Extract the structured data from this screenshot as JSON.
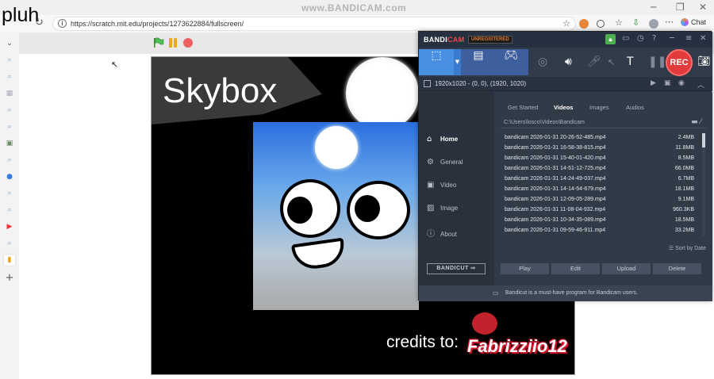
{
  "overlay": {
    "pluh": "pluh",
    "watermark": "www.BANDICAM.com"
  },
  "browser": {
    "url": "https://scratch.mit.edu/projects/1273622884/fullscreen/",
    "chat_label": "Chat",
    "window_controls": {
      "minimize": "─",
      "maximize": "❐",
      "close": "✕"
    }
  },
  "sidebar": {
    "icons": [
      "chevron-down-icon",
      "search-icon",
      "search-icon",
      "image-icon",
      "search-icon",
      "search-icon",
      "photos-icon",
      "search-icon",
      "edge-icon",
      "search-icon",
      "search-icon",
      "youtube-icon",
      "search-icon",
      "scratch-icon",
      "add-icon"
    ]
  },
  "scratch": {
    "stage_title": "Skybox",
    "credits": "credits to:",
    "signature": "Fabrizziio12"
  },
  "bandicam": {
    "logo_a": "BANDI",
    "logo_b": "CAM",
    "unregistered": "UNREGISTERED",
    "rec_label": "REC",
    "resolution": "1920x1020 - (0, 0), (1920, 1020)",
    "nav": [
      {
        "label": "Home",
        "icon": "home-icon"
      },
      {
        "label": "General",
        "icon": "gear-icon"
      },
      {
        "label": "Video",
        "icon": "video-icon"
      },
      {
        "label": "Image",
        "icon": "image-icon"
      },
      {
        "label": "About",
        "icon": "info-icon"
      }
    ],
    "bandicut_label": "BANDICUT",
    "tabs": [
      "Get Started",
      "Videos",
      "Images",
      "Audios"
    ],
    "active_tab": "Videos",
    "path": "C:\\Users\\losco\\Videos\\Bandicam",
    "files": [
      {
        "name": "bandicam 2026-01-31 20-26-52-485.mp4",
        "size": "2.4MB"
      },
      {
        "name": "bandicam 2026-01-31 16-58-38-815.mp4",
        "size": "11.8MB"
      },
      {
        "name": "bandicam 2026-01-31 15-40-01-420.mp4",
        "size": "8.5MB"
      },
      {
        "name": "bandicam 2026-01-31 14-51-12-725.mp4",
        "size": "66.0MB"
      },
      {
        "name": "bandicam 2026-01-31 14-24-49-037.mp4",
        "size": "6.7MB"
      },
      {
        "name": "bandicam 2026-01-31 14-14-54-679.mp4",
        "size": "18.1MB"
      },
      {
        "name": "bandicam 2026-01-31 12-09-05-289.mp4",
        "size": "9.1MB"
      },
      {
        "name": "bandicam 2026-01-31 11-08-04-932.mp4",
        "size": "960.3KB"
      },
      {
        "name": "bandicam 2026-01-31 10-34-35-089.mp4",
        "size": "18.5MB"
      },
      {
        "name": "bandicam 2026-01-31 09-59-46-911.mp4",
        "size": "33.2MB"
      }
    ],
    "sort_label": "Sort by Date",
    "actions": [
      "Play",
      "Edit",
      "Upload",
      "Delete"
    ],
    "footer": "Bandicut is a must-have program for Bandicam users."
  }
}
